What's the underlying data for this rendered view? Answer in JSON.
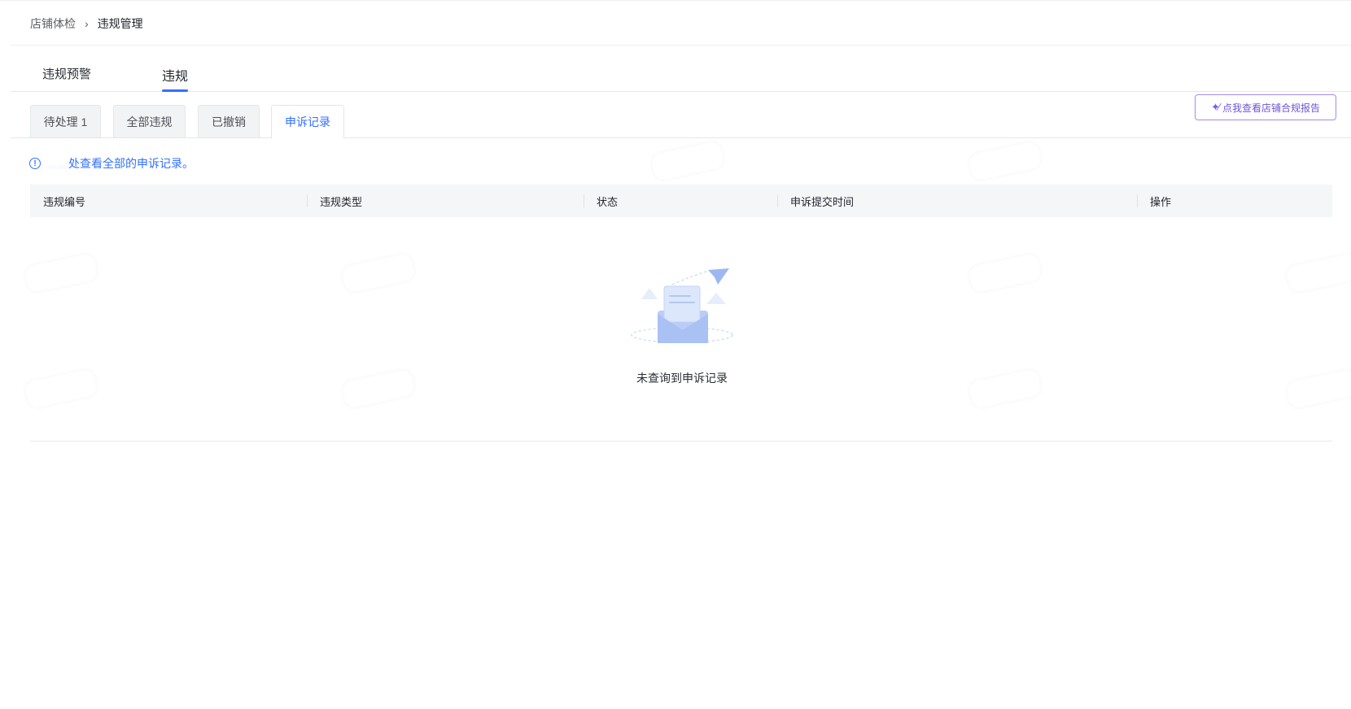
{
  "breadcrumb": {
    "parent": "店铺体检",
    "separator": "›",
    "current": "违规管理"
  },
  "main_tabs": [
    {
      "label": "违规预警",
      "active": false
    },
    {
      "label": "违规",
      "active": true
    }
  ],
  "sub_tabs": [
    {
      "label": "待处理 1",
      "active": false
    },
    {
      "label": "全部违规",
      "active": false
    },
    {
      "label": "已撤销",
      "active": false
    },
    {
      "label": "申诉记录",
      "active": true
    }
  ],
  "report_button": {
    "icon": "sparkle-wand-icon",
    "label": "点我查看店铺合规报告"
  },
  "info": {
    "icon": "info-icon",
    "blurred_prefix": "……",
    "text": "处查看全部的申诉记录。"
  },
  "table": {
    "columns": [
      "违规编号",
      "违规类型",
      "状态",
      "申诉提交时间",
      "操作"
    ],
    "rows": []
  },
  "empty_state": {
    "illustration": "envelope-paper-plane-icon",
    "message": "未查询到申诉记录"
  },
  "colors": {
    "accent": "#3370ff",
    "report_button_border": "#a88be8",
    "report_button_text": "#6f54d8",
    "table_header_bg": "#f5f6f8",
    "sub_tab_bg": "#f2f3f5"
  }
}
